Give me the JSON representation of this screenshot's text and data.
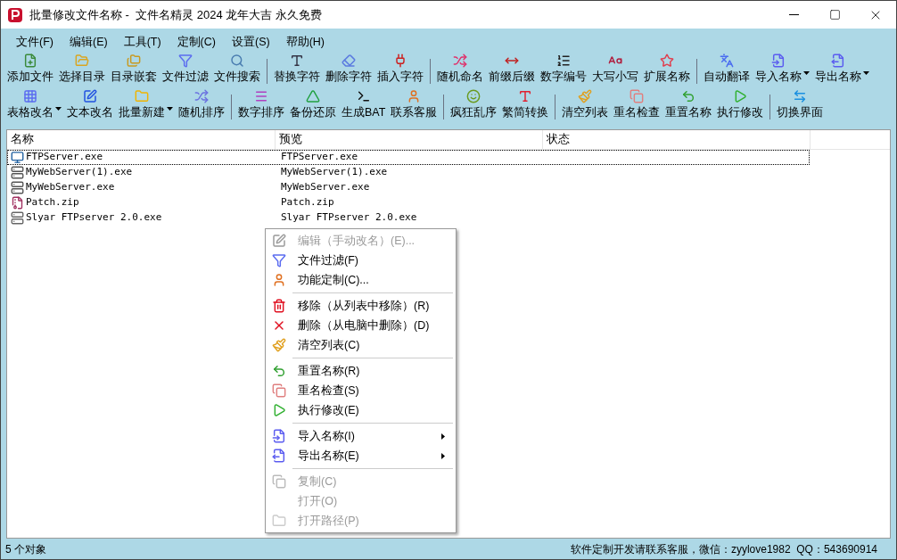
{
  "window": {
    "title": "批量修改文件名称 -  文件名精灵 2024 龙年大吉 永久免费"
  },
  "menu": [
    "文件(F)",
    "编辑(E)",
    "工具(T)",
    "定制(C)",
    "设置(S)",
    "帮助(H)"
  ],
  "toolbar_rows": [
    [
      {
        "kind": "button",
        "label": "添加文件",
        "has_menu": false
      },
      {
        "kind": "button",
        "label": "选择目录",
        "has_menu": false
      },
      {
        "kind": "button",
        "label": "目录嵌套",
        "has_menu": false
      },
      {
        "kind": "button",
        "label": "文件过滤",
        "has_menu": false
      },
      {
        "kind": "button",
        "label": "文件搜索",
        "has_menu": false
      },
      {
        "kind": "separator"
      },
      {
        "kind": "button",
        "label": "替换字符",
        "has_menu": false
      },
      {
        "kind": "button",
        "label": "删除字符",
        "has_menu": false
      },
      {
        "kind": "button",
        "label": "插入字符",
        "has_menu": false
      },
      {
        "kind": "separator"
      },
      {
        "kind": "button",
        "label": "随机命名",
        "has_menu": false
      },
      {
        "kind": "button",
        "label": "前缀后缀",
        "has_menu": false
      },
      {
        "kind": "button",
        "label": "数字编号",
        "has_menu": false
      },
      {
        "kind": "button",
        "label": "大写小写",
        "has_menu": false
      },
      {
        "kind": "button",
        "label": "扩展名称",
        "has_menu": false
      },
      {
        "kind": "separator"
      },
      {
        "kind": "button",
        "label": "自动翻译",
        "has_menu": false
      },
      {
        "kind": "button",
        "label": "导入名称",
        "has_menu": true
      },
      {
        "kind": "button",
        "label": "导出名称",
        "has_menu": true
      }
    ],
    [
      {
        "kind": "button",
        "label": "表格改名",
        "has_menu": true
      },
      {
        "kind": "button",
        "label": "文本改名",
        "has_menu": false
      },
      {
        "kind": "button",
        "label": "批量新建",
        "has_menu": true
      },
      {
        "kind": "button",
        "label": "随机排序",
        "has_menu": false
      },
      {
        "kind": "separator"
      },
      {
        "kind": "button",
        "label": "数字排序",
        "has_menu": false
      },
      {
        "kind": "button",
        "label": "备份还原",
        "has_menu": false
      },
      {
        "kind": "button",
        "label": "生成BAT",
        "has_menu": false
      },
      {
        "kind": "button",
        "label": "联系客服",
        "has_menu": false
      },
      {
        "kind": "separator"
      },
      {
        "kind": "button",
        "label": "疯狂乱序",
        "has_menu": false
      },
      {
        "kind": "button",
        "label": "繁简转换",
        "has_menu": false
      },
      {
        "kind": "separator"
      },
      {
        "kind": "button",
        "label": "清空列表",
        "has_menu": false
      },
      {
        "kind": "button",
        "label": "重名检查",
        "has_menu": false
      },
      {
        "kind": "button",
        "label": "重置名称",
        "has_menu": false
      },
      {
        "kind": "button",
        "label": "执行修改",
        "has_menu": false
      },
      {
        "kind": "separator"
      },
      {
        "kind": "button",
        "label": "切换界面",
        "has_menu": false
      }
    ]
  ],
  "table": {
    "columns": [
      "名称",
      "预览",
      "状态"
    ],
    "rows": [
      {
        "name": "FTPServer.exe",
        "preview": "FTPServer.exe",
        "selected": true
      },
      {
        "name": "MyWebServer(1).exe",
        "preview": "MyWebServer(1).exe",
        "selected": false
      },
      {
        "name": "MyWebServer.exe",
        "preview": "MyWebServer.exe",
        "selected": false
      },
      {
        "name": "Patch.zip",
        "preview": "Patch.zip",
        "selected": false
      },
      {
        "name": "Slyar FTPserver 2.0.exe",
        "preview": "Slyar FTPserver 2.0.exe",
        "selected": false
      }
    ]
  },
  "context_menu": [
    {
      "kind": "item",
      "label": "编辑（手动改名）(E)...",
      "disabled": true,
      "submenu": false
    },
    {
      "kind": "item",
      "label": "文件过滤(F)",
      "disabled": false,
      "submenu": false
    },
    {
      "kind": "item",
      "label": "功能定制(C)...",
      "disabled": false,
      "submenu": false
    },
    {
      "kind": "separator"
    },
    {
      "kind": "item",
      "label": "移除（从列表中移除）(R)",
      "disabled": false,
      "submenu": false
    },
    {
      "kind": "item",
      "label": "删除（从电脑中删除）(D)",
      "disabled": false,
      "submenu": false
    },
    {
      "kind": "item",
      "label": "清空列表(C)",
      "disabled": false,
      "submenu": false
    },
    {
      "kind": "separator"
    },
    {
      "kind": "item",
      "label": "重置名称(R)",
      "disabled": false,
      "submenu": false
    },
    {
      "kind": "item",
      "label": "重名检查(S)",
      "disabled": false,
      "submenu": false
    },
    {
      "kind": "item",
      "label": "执行修改(E)",
      "disabled": false,
      "submenu": false
    },
    {
      "kind": "separator"
    },
    {
      "kind": "item",
      "label": "导入名称(I)",
      "disabled": false,
      "submenu": true
    },
    {
      "kind": "item",
      "label": "导出名称(E)",
      "disabled": false,
      "submenu": true
    },
    {
      "kind": "separator"
    },
    {
      "kind": "item",
      "label": "复制(C)",
      "disabled": true,
      "submenu": false
    },
    {
      "kind": "item",
      "label": "打开(O)",
      "disabled": true,
      "submenu": false
    },
    {
      "kind": "item",
      "label": "打开路径(P)",
      "disabled": true,
      "submenu": false
    }
  ],
  "status_bar": {
    "count": "5 个对象",
    "contact": "软件定制开发请联系客服，微信：zyylove1982  QQ：543690914"
  }
}
